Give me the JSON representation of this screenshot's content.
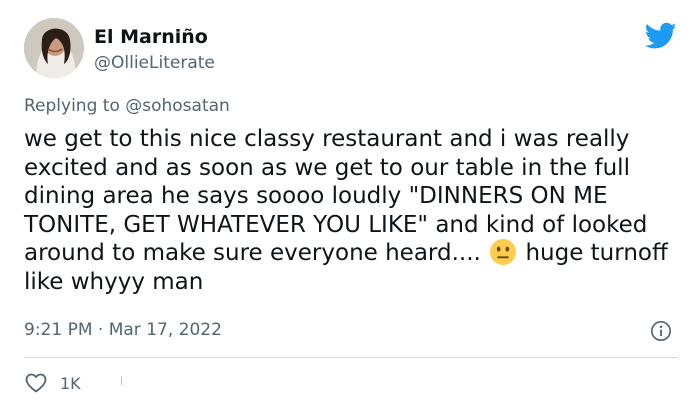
{
  "author": {
    "display_name": "El Marniño",
    "handle": "@OllieLiterate"
  },
  "reply": {
    "prefix": "Replying to",
    "mention": "@sohosatan"
  },
  "tweet": {
    "text_before_emoji": "we get to this nice classy restaurant and i was really excited and as soon as we get to our table in the full dining area he says soooo loudly \"DINNERS ON ME TONITE, GET WHATEVER YOU LIKE\" and kind of looked around to make sure everyone heard.... ",
    "emoji": "neutral-face",
    "text_after_emoji": " huge turnoff like whyyy man"
  },
  "meta": {
    "timestamp": "9:21 PM · Mar 17, 2022"
  },
  "actions": {
    "like_count": "1K"
  },
  "colors": {
    "brand_blue": "#1d9bf0",
    "secondary_text": "#536471",
    "primary_text": "#0f1419",
    "divider": "#cfd9de"
  },
  "icons": [
    "twitter-bird-icon",
    "info-icon",
    "heart-icon",
    "neutral-face-emoji"
  ]
}
